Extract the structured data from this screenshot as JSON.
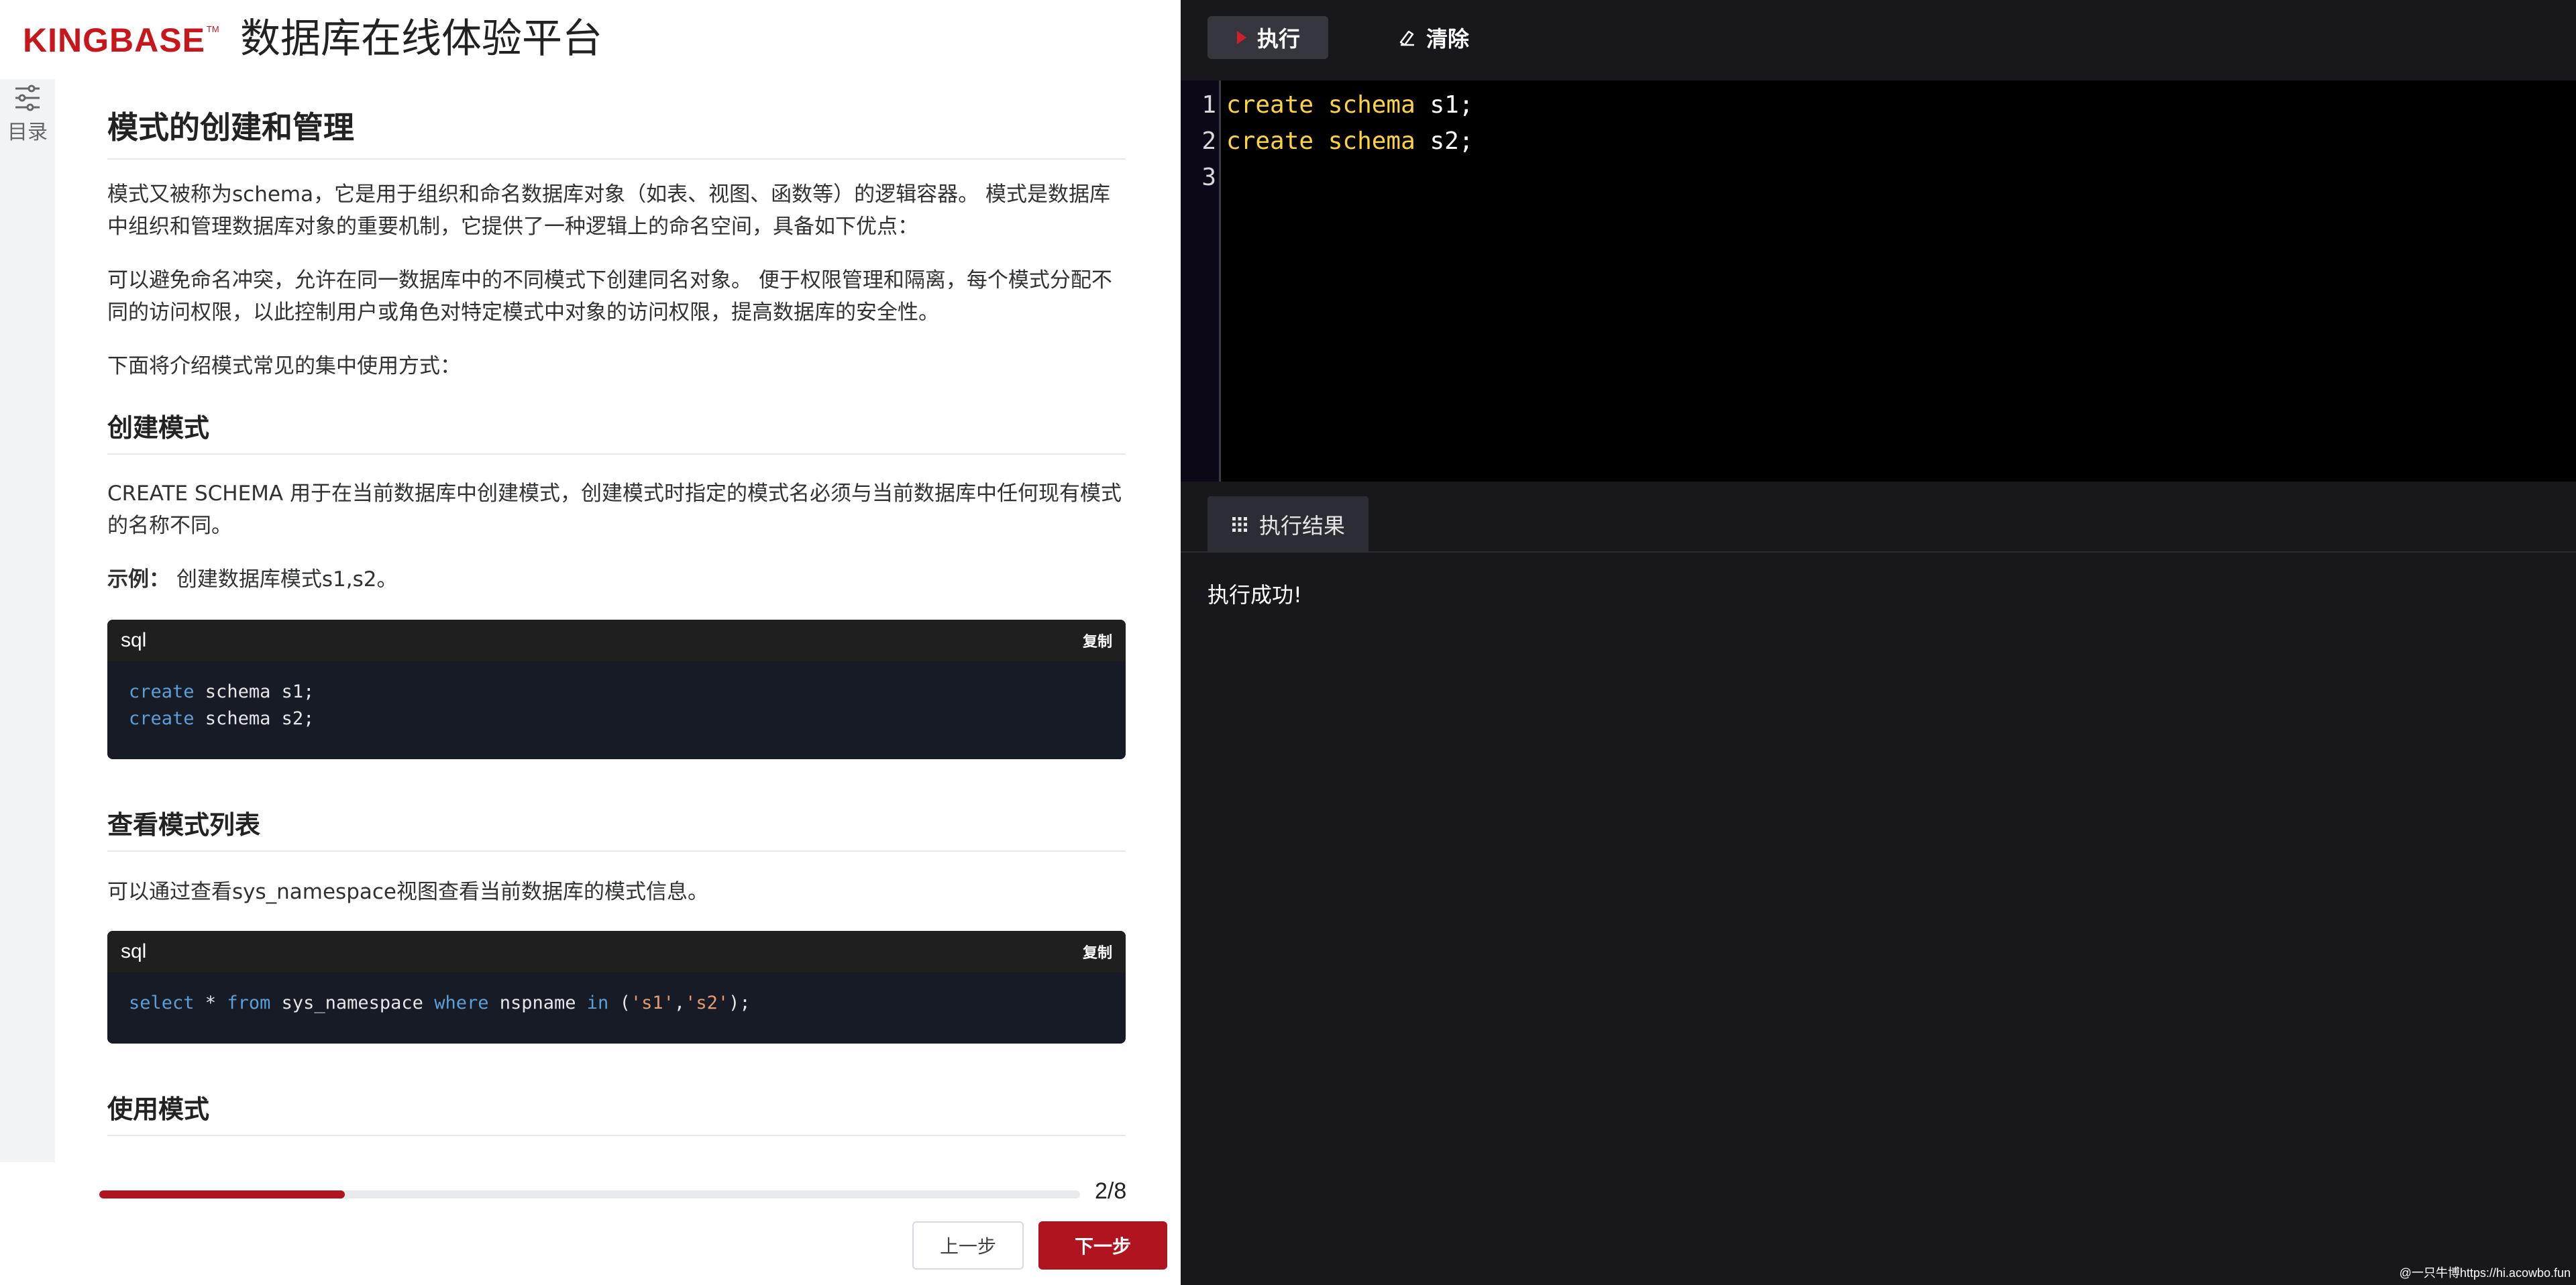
{
  "header": {
    "logo_text": "KINGBASE",
    "logo_tm": "TM",
    "site_title": "数据库在线体验平台"
  },
  "toc": {
    "label": "目录"
  },
  "doc": {
    "title": "模式的创建和管理",
    "intro_1": "模式又被称为schema，它是用于组织和命名数据库对象（如表、视图、函数等）的逻辑容器。 模式是数据库中组织和管理数据库对象的重要机制，它提供了一种逻辑上的命名空间，具备如下优点：",
    "intro_2": "可以避免命名冲突，允许在同一数据库中的不同模式下创建同名对象。 便于权限管理和隔离，每个模式分配不同的访问权限，以此控制用户或角色对特定模式中对象的访问权限，提高数据库的安全性。",
    "intro_3": "下面将介绍模式常见的集中使用方式：",
    "section_create": {
      "heading": "创建模式",
      "desc": "CREATE SCHEMA 用于在当前数据库中创建模式，创建模式时指定的模式名必须与当前数据库中任何现有模式的名称不同。",
      "example_label": "示例：",
      "example_text": "创建数据库模式s1,s2。",
      "code": {
        "lang": "sql",
        "copy_label": "复制",
        "line1_kw": "create",
        "line1_rest": " schema s1;",
        "line2_kw": "create",
        "line2_rest": " schema s2;"
      }
    },
    "section_list": {
      "heading": "查看模式列表",
      "desc": "可以通过查看sys_namespace视图查看当前数据库的模式信息。",
      "code": {
        "lang": "sql",
        "copy_label": "复制",
        "t1": "select",
        "t2": " * ",
        "t3": "from",
        "t4": " sys_namespace ",
        "t5": "where",
        "t6": " nspname ",
        "t7": "in",
        "t8": " (",
        "t9": "'s1'",
        "t10": ",",
        "t11": "'s2'",
        "t12": ");"
      }
    },
    "section_use": {
      "heading": "使用模式"
    }
  },
  "footer": {
    "progress_fraction": 0.25,
    "progress_text": "2/8",
    "prev_label": "上一步",
    "next_label": "下一步"
  },
  "toolbar": {
    "run_label": "执行",
    "clear_label": "清除",
    "run_icon": "play-icon",
    "clear_icon": "eraser-icon",
    "run_icon_color": "#d0202a"
  },
  "editor": {
    "line_numbers": [
      "1",
      "2",
      "3"
    ],
    "line1_kw1": "create",
    "line1_kw2": "schema",
    "line1_rest": " s1;",
    "line2_kw1": "create",
    "line2_kw2": "schema",
    "line2_rest": " s2;"
  },
  "results": {
    "tab_label": "执行结果",
    "tab_icon": "grid-icon",
    "message": "执行成功!"
  },
  "watermark": "@一只牛博https://hi.acowbo.fun"
}
